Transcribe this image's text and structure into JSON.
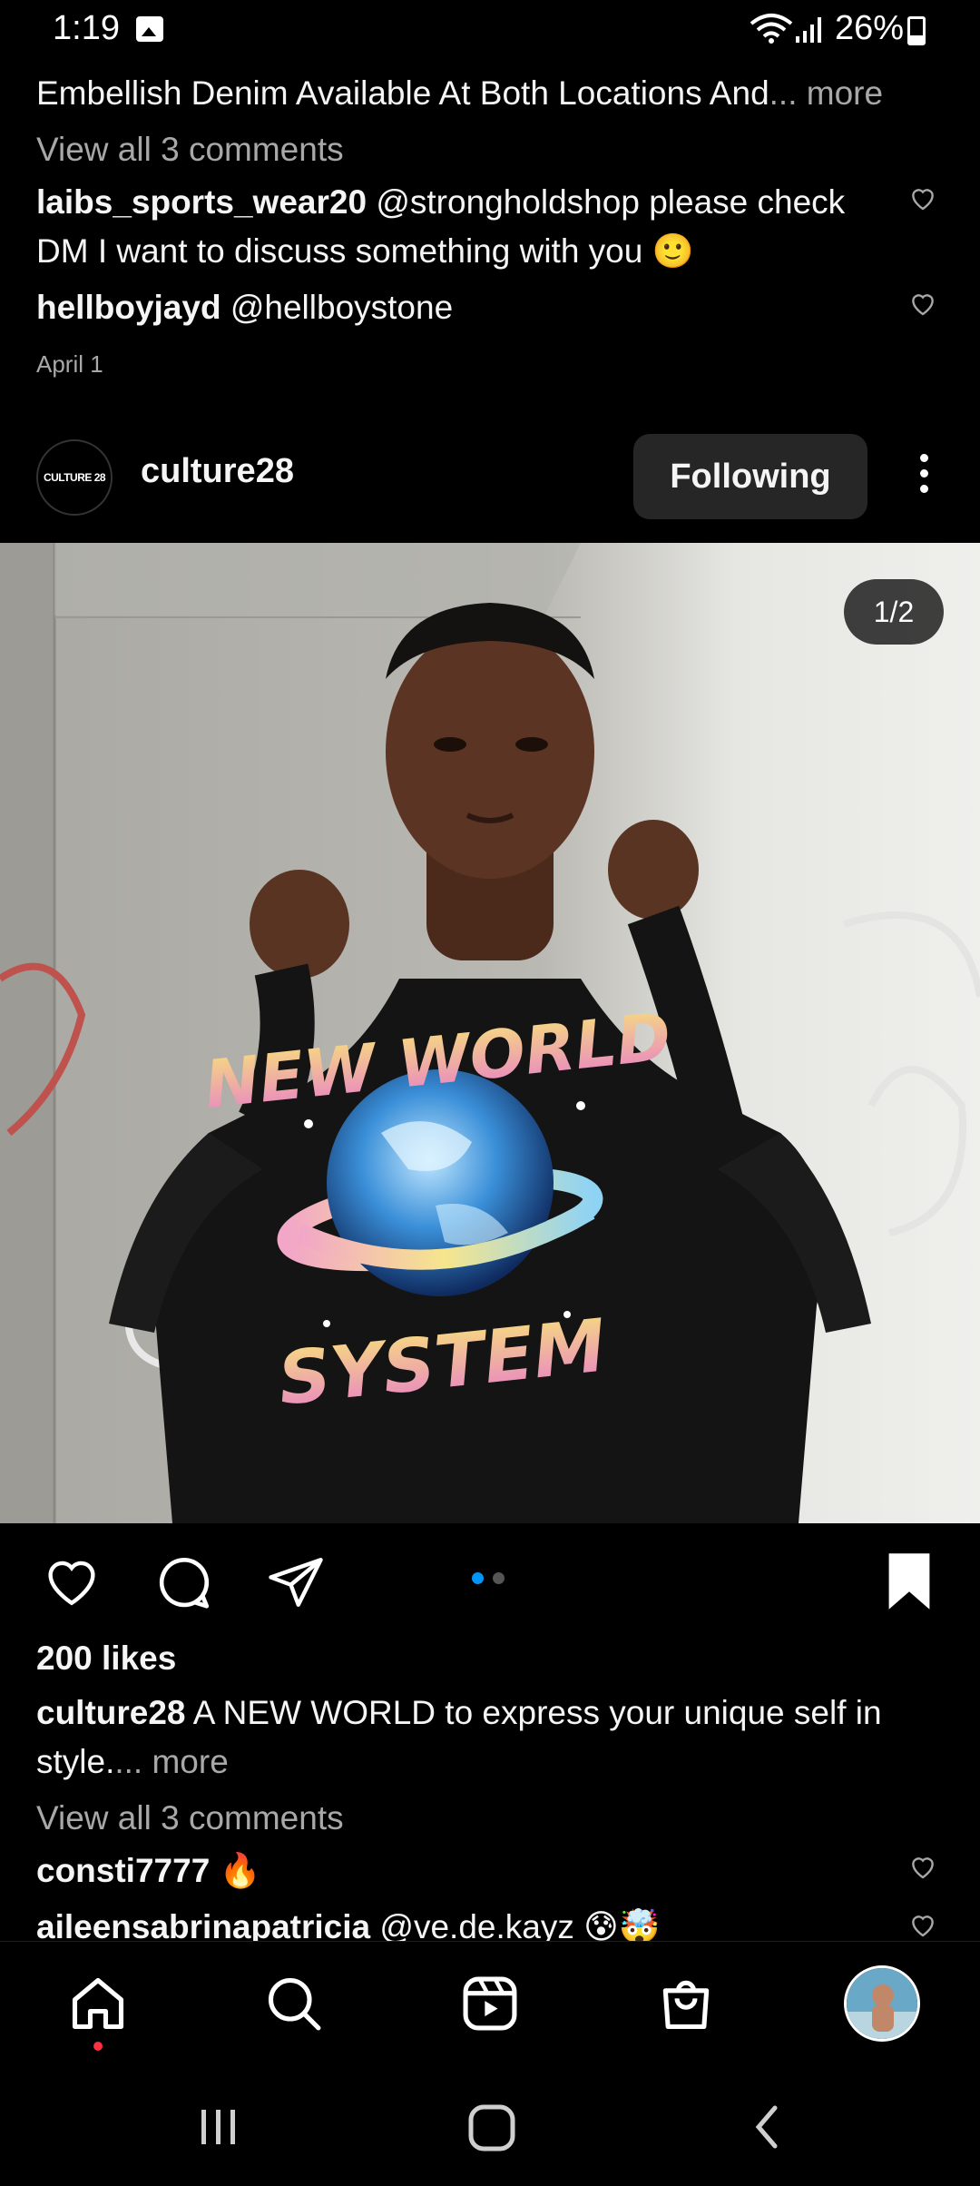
{
  "status_bar": {
    "time": "1:19",
    "battery": "26%"
  },
  "prev_post": {
    "caption_tail": "Embellish Denim Available At Both Locations And",
    "more_label": "... more",
    "view_comments": "View all 3 comments",
    "comments": [
      {
        "user": "laibs_sports_wear20",
        "text_line1": "@strongholdshop please check",
        "text_line2": "DM I want to discuss something with you 🙂"
      },
      {
        "user": "hellboyjayd",
        "text": "@hellboystone"
      }
    ],
    "date": "April 1"
  },
  "post": {
    "avatar_text": "CULTURE 28",
    "username": "culture28",
    "follow_label": "Following",
    "image_counter": "1/2",
    "shirt_text_top": "NEW WORLD",
    "shirt_text_bottom": "SYSTEM",
    "likes": "200 likes",
    "caption_user": "culture28",
    "caption_text": "A NEW WORLD to express your unique self in",
    "caption_text2": "style.",
    "caption_more": "... more",
    "view_comments": "View all 3 comments",
    "comments": [
      {
        "user": "consti7777",
        "text": "🔥"
      },
      {
        "user": "aileensabrinapatricia",
        "text": "@ve.de.kayz 😰🤯"
      }
    ]
  },
  "colors": {
    "background": "#000000",
    "text": "#f5f5f5",
    "muted": "#a8a8a8",
    "button": "#262626",
    "accent_blue": "#0095f6",
    "notify_red": "#ff3040"
  },
  "icons": [
    "gallery-icon",
    "wifi-icon",
    "signal-icon",
    "battery-icon",
    "heart-icon",
    "comment-icon",
    "share-icon",
    "bookmark-icon",
    "home-icon",
    "search-icon",
    "reels-icon",
    "shop-icon",
    "recents-icon",
    "home-button-icon",
    "back-icon"
  ]
}
